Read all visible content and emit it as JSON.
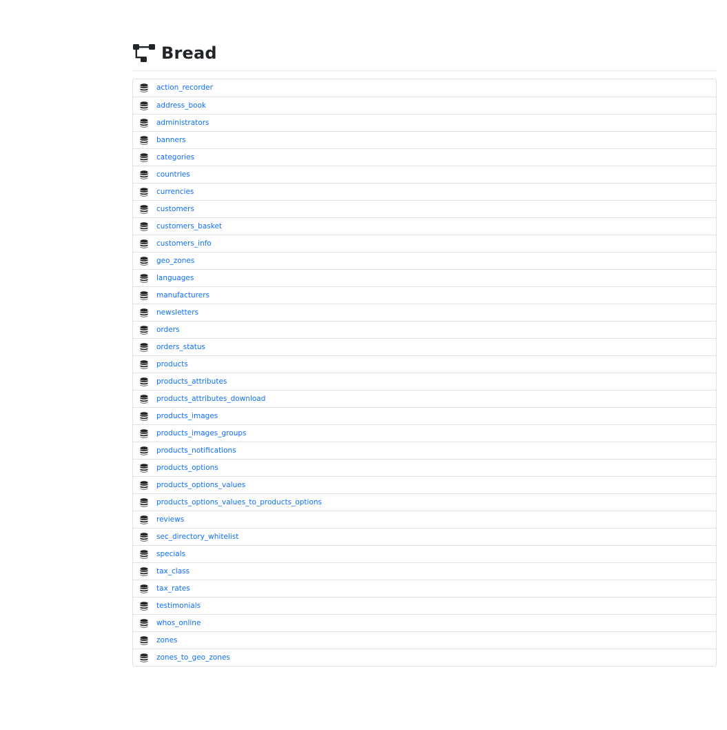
{
  "header": {
    "title": "Bread",
    "icon": "sitemap-icon"
  },
  "tables": {
    "icon": "database-icon",
    "link_color": "#0d6efd",
    "items": [
      "action_recorder",
      "address_book",
      "administrators",
      "banners",
      "categories",
      "countries",
      "currencies",
      "customers",
      "customers_basket",
      "customers_info",
      "geo_zones",
      "languages",
      "manufacturers",
      "newsletters",
      "orders",
      "orders_status",
      "products",
      "products_attributes",
      "products_attributes_download",
      "products_images",
      "products_images_groups",
      "products_notifications",
      "products_options",
      "products_options_values",
      "products_options_values_to_products_options",
      "reviews",
      "sec_directory_whitelist",
      "specials",
      "tax_class",
      "tax_rates",
      "testimonials",
      "whos_online",
      "zones",
      "zones_to_geo_zones"
    ]
  }
}
